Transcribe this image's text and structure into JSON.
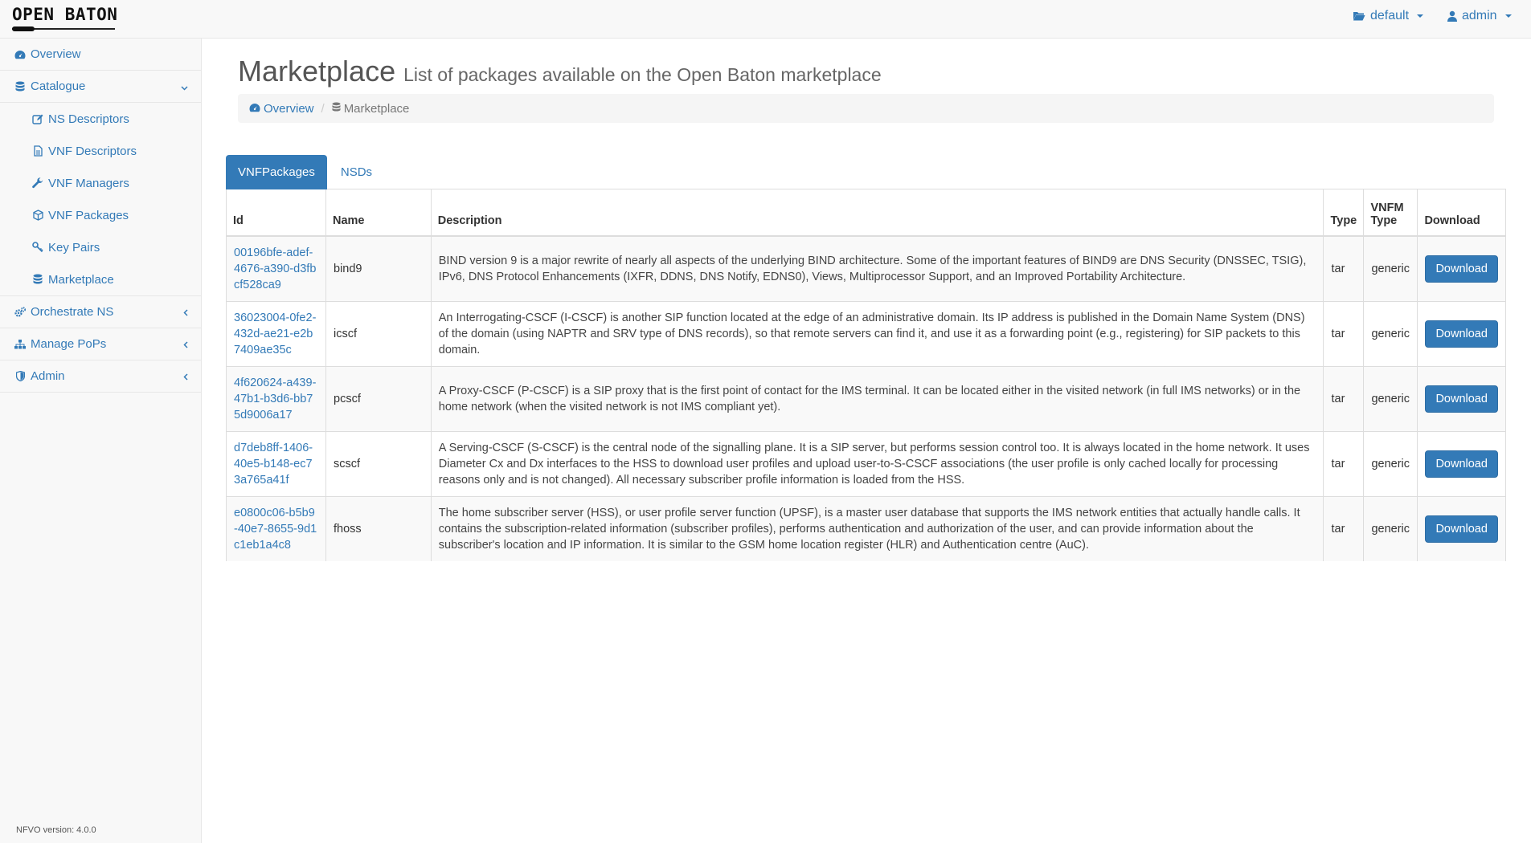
{
  "brand": "OPEN BATON",
  "topnav": {
    "project": "default",
    "user": "admin"
  },
  "sidebar": {
    "overview": "Overview",
    "catalogue": "Catalogue",
    "catalogue_items": [
      {
        "label": "NS Descriptors",
        "icon": "edit-icon"
      },
      {
        "label": "VNF Descriptors",
        "icon": "file-icon"
      },
      {
        "label": "VNF Managers",
        "icon": "wrench-icon"
      },
      {
        "label": "VNF Packages",
        "icon": "cube-icon"
      },
      {
        "label": "Key Pairs",
        "icon": "key-icon"
      },
      {
        "label": "Marketplace",
        "icon": "database-icon"
      }
    ],
    "orchestrate": "Orchestrate NS",
    "pops": "Manage PoPs",
    "admin": "Admin",
    "version": "NFVO version: 4.0.0"
  },
  "page": {
    "title": "Marketplace",
    "subtitle": "List of packages available on the Open Baton marketplace"
  },
  "breadcrumb": {
    "home": "Overview",
    "current": "Marketplace"
  },
  "tabs": [
    "VNFPackages",
    "NSDs"
  ],
  "table": {
    "headers": [
      "Id",
      "Name",
      "Description",
      "Type",
      "VNFM Type",
      "Download"
    ],
    "rows": [
      {
        "id": "00196bfe-adef-4676-a390-d3fbcf528ca9",
        "name": "bind9",
        "description": "BIND version 9 is a major rewrite of nearly all aspects of the underlying BIND architecture. Some of the important features of BIND9 are DNS Security (DNSSEC, TSIG), IPv6, DNS Protocol Enhancements (IXFR, DDNS, DNS Notify, EDNS0), Views, Multiprocessor Support, and an Improved Portability Architecture.",
        "type": "tar",
        "vnfm_type": "generic",
        "download": "Download"
      },
      {
        "id": "36023004-0fe2-432d-ae21-e2b7409ae35c",
        "name": "icscf",
        "description": "An Interrogating-CSCF (I-CSCF) is another SIP function located at the edge of an administrative domain. Its IP address is published in the Domain Name System (DNS) of the domain (using NAPTR and SRV type of DNS records), so that remote servers can find it, and use it as a forwarding point (e.g., registering) for SIP packets to this domain.",
        "type": "tar",
        "vnfm_type": "generic",
        "download": "Download"
      },
      {
        "id": "4f620624-a439-47b1-b3d6-bb75d9006a17",
        "name": "pcscf",
        "description": "A Proxy-CSCF (P-CSCF) is a SIP proxy that is the first point of contact for the IMS terminal. It can be located either in the visited network (in full IMS networks) or in the home network (when the visited network is not IMS compliant yet).",
        "type": "tar",
        "vnfm_type": "generic",
        "download": "Download"
      },
      {
        "id": "d7deb8ff-1406-40e5-b148-ec73a765a41f",
        "name": "scscf",
        "description": "A Serving-CSCF (S-CSCF) is the central node of the signalling plane. It is a SIP server, but performs session control too. It is always located in the home network. It uses Diameter Cx and Dx interfaces to the HSS to download user profiles and upload user-to-S-CSCF associations (the user profile is only cached locally for processing reasons only and is not changed). All necessary subscriber profile information is loaded from the HSS.",
        "type": "tar",
        "vnfm_type": "generic",
        "download": "Download"
      },
      {
        "id": "e0800c06-b5b9-40e7-8655-9d1c1eb1a4c8",
        "name": "fhoss",
        "description": "The home subscriber server (HSS), or user profile server function (UPSF), is a master user database that supports the IMS network entities that actually handle calls. It contains the subscription-related information (subscriber profiles), performs authentication and authorization of the user, and can provide information about the subscriber's location and IP information. It is similar to the GSM home location register (HLR) and Authentication centre (AuC).",
        "type": "tar",
        "vnfm_type": "generic",
        "download": "Download"
      }
    ]
  },
  "colors": {
    "link": "#337ab7",
    "sidebar_bg": "#f8f8f8",
    "border": "#e7e7e7"
  }
}
